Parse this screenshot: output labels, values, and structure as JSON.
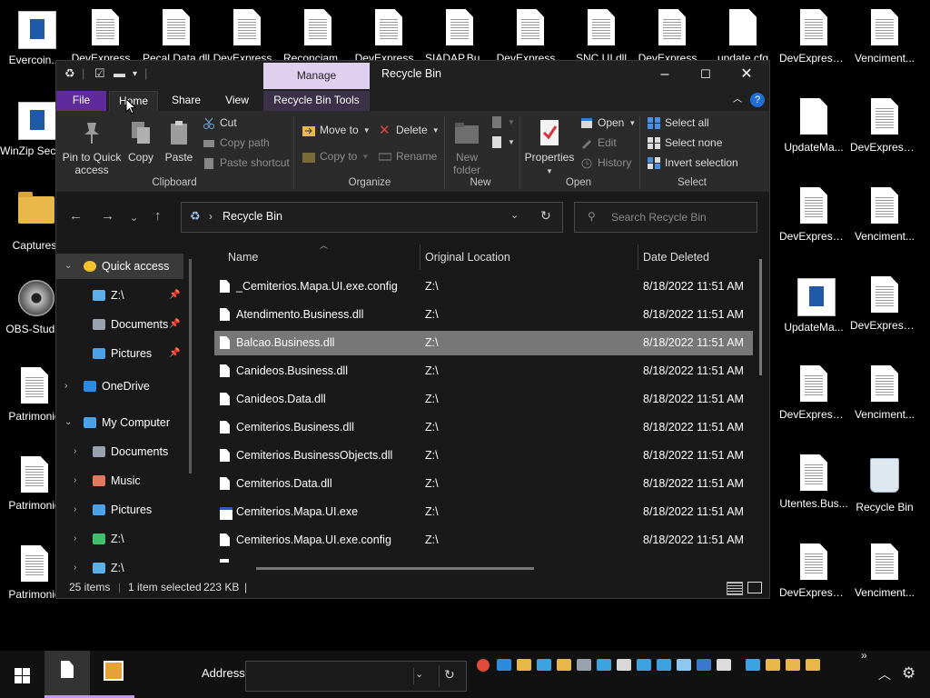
{
  "desktop": {
    "icons_top": [
      {
        "label": "Evercoin...",
        "type": "pdf"
      },
      {
        "label": "DevExpress...",
        "type": "doc"
      },
      {
        "label": "Pecal.Data.dll",
        "type": "doc"
      },
      {
        "label": "DevExpress...",
        "type": "doc"
      },
      {
        "label": "Reconciamo...",
        "type": "doc"
      },
      {
        "label": "DevExpress...",
        "type": "doc"
      },
      {
        "label": "SIADAP.Bus...",
        "type": "doc"
      },
      {
        "label": "DevExpress...",
        "type": "doc"
      },
      {
        "label": "SNC.UI.dll",
        "type": "doc"
      },
      {
        "label": "DevExpress...",
        "type": "doc"
      },
      {
        "label": "update.cfg",
        "type": "blank"
      },
      {
        "label": "DevExpress....",
        "type": "doc"
      },
      {
        "label": "Venciment...",
        "type": "doc"
      }
    ],
    "icons_left": [
      {
        "label": "WinZip Secur...",
        "type": "winzip"
      },
      {
        "label": "Captures",
        "type": "folder"
      },
      {
        "label": "OBS-Studio",
        "type": "obs"
      },
      {
        "label": "Patrimonio",
        "type": "doc"
      },
      {
        "label": "Patrimonio",
        "type": "doc"
      },
      {
        "label": "Patrimonio",
        "type": "doc"
      }
    ],
    "icons_right_col1": [
      {
        "label": "UpdateMa...",
        "type": "blank"
      },
      {
        "label": "DevExpress....",
        "type": "doc"
      },
      {
        "label": "UpdateMa...",
        "type": "app"
      },
      {
        "label": "DevExpress....",
        "type": "doc"
      },
      {
        "label": "Utentes.Bus...",
        "type": "doc"
      },
      {
        "label": "DevExpress....",
        "type": "doc"
      }
    ],
    "icons_right_col2": [
      {
        "label": "DevExpress....",
        "type": "doc"
      },
      {
        "label": "Venciment...",
        "type": "doc"
      },
      {
        "label": "DevExpress....",
        "type": "doc"
      },
      {
        "label": "Venciment...",
        "type": "doc"
      },
      {
        "label": "Recycle Bin",
        "type": "bin"
      },
      {
        "label": "Venciment...",
        "type": "doc"
      }
    ]
  },
  "explorer": {
    "title": "Recycle Bin",
    "context_tab_group": "Manage",
    "tabs": {
      "file": "File",
      "home": "Home",
      "share": "Share",
      "view": "View",
      "context": "Recycle Bin Tools"
    },
    "ribbon": {
      "clipboard": {
        "label": "Clipboard",
        "pin": "Pin to Quick access",
        "copy": "Copy",
        "paste": "Paste",
        "cut": "Cut",
        "copy_path": "Copy path",
        "paste_shortcut": "Paste shortcut"
      },
      "organize": {
        "label": "Organize",
        "move_to": "Move to",
        "copy_to": "Copy to",
        "delete": "Delete",
        "rename": "Rename"
      },
      "new": {
        "label": "New",
        "new_folder": "New folder"
      },
      "open": {
        "label": "Open",
        "properties": "Properties",
        "open": "Open",
        "edit": "Edit",
        "history": "History"
      },
      "select": {
        "label": "Select",
        "select_all": "Select all",
        "select_none": "Select none",
        "invert": "Invert selection"
      }
    },
    "address": {
      "path": "Recycle Bin",
      "search_placeholder": "Search Recycle Bin"
    },
    "nav_pane": [
      {
        "label": "Quick access",
        "level": 0,
        "expanded": true,
        "selected": true,
        "icon": "star-icon"
      },
      {
        "label": "Z:\\",
        "level": 1,
        "pinned": true,
        "icon": "drive-icon"
      },
      {
        "label": "Documents",
        "level": 1,
        "pinned": true,
        "icon": "documents-icon"
      },
      {
        "label": "Pictures",
        "level": 1,
        "pinned": true,
        "icon": "pictures-icon"
      },
      {
        "label": "OneDrive",
        "level": 0,
        "expanded": false,
        "icon": "cloud-icon"
      },
      {
        "label": "My Computer",
        "level": 0,
        "expanded": true,
        "icon": "computer-icon"
      },
      {
        "label": "Documents",
        "level": 1,
        "expanded": false,
        "icon": "documents-icon"
      },
      {
        "label": "Music",
        "level": 1,
        "expanded": false,
        "icon": "music-icon"
      },
      {
        "label": "Pictures",
        "level": 1,
        "expanded": false,
        "icon": "pictures-icon"
      },
      {
        "label": "Z:\\",
        "level": 1,
        "expanded": false,
        "icon": "download-icon"
      },
      {
        "label": "Z:\\",
        "level": 1,
        "expanded": false,
        "icon": "drive-icon"
      }
    ],
    "columns": {
      "name": "Name",
      "original_location": "Original Location",
      "date_deleted": "Date Deleted"
    },
    "files": [
      {
        "name": "_Cemiterios.Mapa.UI.exe.config",
        "location": "Z:\\",
        "date": "8/18/2022 11:51 AM",
        "kind": "file"
      },
      {
        "name": "Atendimento.Business.dll",
        "location": "Z:\\",
        "date": "8/18/2022 11:51 AM",
        "kind": "file"
      },
      {
        "name": "Balcao.Business.dll",
        "location": "Z:\\",
        "date": "8/18/2022 11:51 AM",
        "kind": "file",
        "selected": true
      },
      {
        "name": "Canideos.Business.dll",
        "location": "Z:\\",
        "date": "8/18/2022 11:51 AM",
        "kind": "file"
      },
      {
        "name": "Canideos.Data.dll",
        "location": "Z:\\",
        "date": "8/18/2022 11:51 AM",
        "kind": "file"
      },
      {
        "name": "Cemiterios.Business.dll",
        "location": "Z:\\",
        "date": "8/18/2022 11:51 AM",
        "kind": "file"
      },
      {
        "name": "Cemiterios.BusinessObjects.dll",
        "location": "Z:\\",
        "date": "8/18/2022 11:51 AM",
        "kind": "file"
      },
      {
        "name": "Cemiterios.Data.dll",
        "location": "Z:\\",
        "date": "8/18/2022 11:51 AM",
        "kind": "file"
      },
      {
        "name": "Cemiterios.Mapa.UI.exe",
        "location": "Z:\\",
        "date": "8/18/2022 11:51 AM",
        "kind": "exe"
      },
      {
        "name": "Cemiterios.Mapa.UI.exe.config",
        "location": "Z:\\",
        "date": "8/18/2022 11:51 AM",
        "kind": "file"
      }
    ],
    "status": {
      "count": "25 items",
      "selected": "1 item selected",
      "size": "223 KB"
    }
  },
  "taskbar": {
    "address_label": "Address",
    "address_value": ""
  }
}
